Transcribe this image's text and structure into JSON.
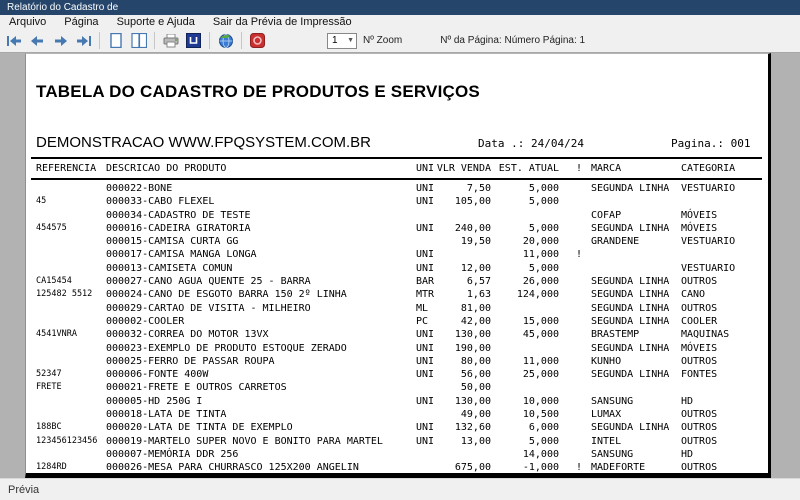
{
  "window": {
    "title": "Relatório do Cadastro de"
  },
  "menu": {
    "items": [
      "Arquivo",
      "Página",
      "Suporte e Ajuda",
      "Sair da Prévia de Impressão"
    ]
  },
  "toolbar": {
    "buttons": [
      "first-page",
      "previous-page",
      "next-page",
      "last-page",
      "single-page-view",
      "two-page-view",
      "print",
      "page-setup",
      "web-export",
      "close-preview"
    ],
    "zoom_value": "1",
    "zoom_label": "Nº Zoom",
    "page_info": "Nº da Página: Número Página: 1"
  },
  "colors": {
    "titlebar": "#25456b",
    "accent_blue": "#4679b2",
    "toolbar_bg": "#f0f0f0",
    "preview_bg": "#b2b2b2",
    "close_red": "#c93030"
  },
  "report": {
    "title": "TABELA DO CADASTRO DE PRODUTOS E SERVIÇOS",
    "subtitle": "DEMONSTRACAO WWW.FPQSYSTEM.COM.BR",
    "date_label": "Data .: 24/04/24",
    "page_label": "Pagina.: 001",
    "columns": [
      "REFERENCIA",
      "DESCRICAO DO PRODUTO",
      "UNI",
      "VLR VENDA",
      "EST. ATUAL",
      "!",
      "MARCA",
      "CATEGORIA"
    ],
    "rows": [
      {
        "ref": "",
        "desc": "000022-BONE",
        "uni": "UNI",
        "vlr": "7,50",
        "est": "5,000",
        "flag": "",
        "marca": "SEGUNDA LINHA",
        "cat": "VESTUARIO"
      },
      {
        "ref": "45",
        "desc": "000033-CABO FLEXEL",
        "uni": "UNI",
        "vlr": "105,00",
        "est": "5,000",
        "flag": "",
        "marca": "",
        "cat": ""
      },
      {
        "ref": "",
        "desc": "000034-CADASTRO DE TESTE",
        "uni": "",
        "vlr": "",
        "est": "",
        "flag": "",
        "marca": "COFAP",
        "cat": "MÓVEIS"
      },
      {
        "ref": "454575",
        "desc": "000016-CADEIRA GIRATORIA",
        "uni": "UNI",
        "vlr": "240,00",
        "est": "5,000",
        "flag": "",
        "marca": "SEGUNDA LINHA",
        "cat": "MÓVEIS"
      },
      {
        "ref": "",
        "desc": "000015-CAMISA CURTA GG",
        "uni": "",
        "vlr": "19,50",
        "est": "20,000",
        "flag": "",
        "marca": "GRANDENE",
        "cat": "VESTUARIO"
      },
      {
        "ref": "",
        "desc": "000017-CAMISA MANGA LONGA",
        "uni": "UNI",
        "vlr": "",
        "est": "11,000",
        "flag": "!",
        "marca": "",
        "cat": ""
      },
      {
        "ref": "",
        "desc": "000013-CAMISETA COMUN",
        "uni": "UNI",
        "vlr": "12,00",
        "est": "5,000",
        "flag": "",
        "marca": "",
        "cat": "VESTUARIO"
      },
      {
        "ref": "CA15454",
        "desc": "000027-CANO AGUA QUENTE 25 - BARRA",
        "uni": "BAR",
        "vlr": "6,57",
        "est": "26,000",
        "flag": "",
        "marca": "SEGUNDA LINHA",
        "cat": "OUTROS"
      },
      {
        "ref": "125482 5512",
        "desc": "000024-CANO DE ESGOTO BARRA 150 2º LINHA",
        "uni": "MTR",
        "vlr": "1,63",
        "est": "124,000",
        "flag": "",
        "marca": "SEGUNDA LINHA",
        "cat": "CANO"
      },
      {
        "ref": "",
        "desc": "000029-CARTAO DE VISITA - MILHEIRO",
        "uni": "ML",
        "vlr": "81,00",
        "est": "",
        "flag": "",
        "marca": "SEGUNDA LINHA",
        "cat": "OUTROS"
      },
      {
        "ref": "",
        "desc": "000002-COOLER",
        "uni": "PC",
        "vlr": "42,00",
        "est": "15,000",
        "flag": "",
        "marca": "SEGUNDA LINHA",
        "cat": "COOLER"
      },
      {
        "ref": "4541VNRA",
        "desc": "000032-CORREA DO MOTOR 13VX",
        "uni": "UNI",
        "vlr": "130,00",
        "est": "45,000",
        "flag": "",
        "marca": "BRASTEMP",
        "cat": "MAQUINAS"
      },
      {
        "ref": "",
        "desc": "000023-EXEMPLO DE PRODUTO ESTOQUE ZERADO",
        "uni": "UNI",
        "vlr": "190,00",
        "est": "",
        "flag": "",
        "marca": "SEGUNDA LINHA",
        "cat": "MÓVEIS"
      },
      {
        "ref": "",
        "desc": "000025-FERRO DE PASSAR ROUPA",
        "uni": "UNI",
        "vlr": "80,00",
        "est": "11,000",
        "flag": "",
        "marca": "KUNHO",
        "cat": "OUTROS"
      },
      {
        "ref": "52347",
        "desc": "000006-FONTE 400W",
        "uni": "UNI",
        "vlr": "56,00",
        "est": "25,000",
        "flag": "",
        "marca": "SEGUNDA LINHA",
        "cat": "FONTES"
      },
      {
        "ref": "FRETE",
        "desc": "000021-FRETE E OUTROS CARRETOS",
        "uni": "",
        "vlr": "50,00",
        "est": "",
        "flag": "",
        "marca": "",
        "cat": ""
      },
      {
        "ref": "",
        "desc": "000005-HD 250G  I",
        "uni": "UNI",
        "vlr": "130,00",
        "est": "10,000",
        "flag": "",
        "marca": "SANSUNG",
        "cat": "HD"
      },
      {
        "ref": "",
        "desc": "000018-LATA DE TINTA",
        "uni": "",
        "vlr": "49,00",
        "est": "10,500",
        "flag": "",
        "marca": "LUMAX",
        "cat": "OUTROS"
      },
      {
        "ref": "188BC",
        "desc": "000020-LATA DE TINTA DE EXEMPLO",
        "uni": "UNI",
        "vlr": "132,60",
        "est": "6,000",
        "flag": "",
        "marca": "SEGUNDA LINHA",
        "cat": "OUTROS"
      },
      {
        "ref": "123456123456",
        "desc": "000019-MARTELO SUPER NOVO E BONITO PARA MARTEL",
        "uni": "UNI",
        "vlr": "13,00",
        "est": "5,000",
        "flag": "",
        "marca": "INTEL",
        "cat": "OUTROS"
      },
      {
        "ref": "",
        "desc": "000007-MEMÓRIA DDR 256",
        "uni": "",
        "vlr": "",
        "est": "14,000",
        "flag": "",
        "marca": "SANSUNG",
        "cat": "HD"
      },
      {
        "ref": "1284RD",
        "desc": "000026-MESA PARA CHURRASCO 125X200 ANGELIN",
        "uni": "",
        "vlr": "675,00",
        "est": "-1,000",
        "flag": "!",
        "marca": "MADEFORTE",
        "cat": "OUTROS"
      }
    ]
  },
  "statusbar": {
    "text": "Prévia"
  }
}
